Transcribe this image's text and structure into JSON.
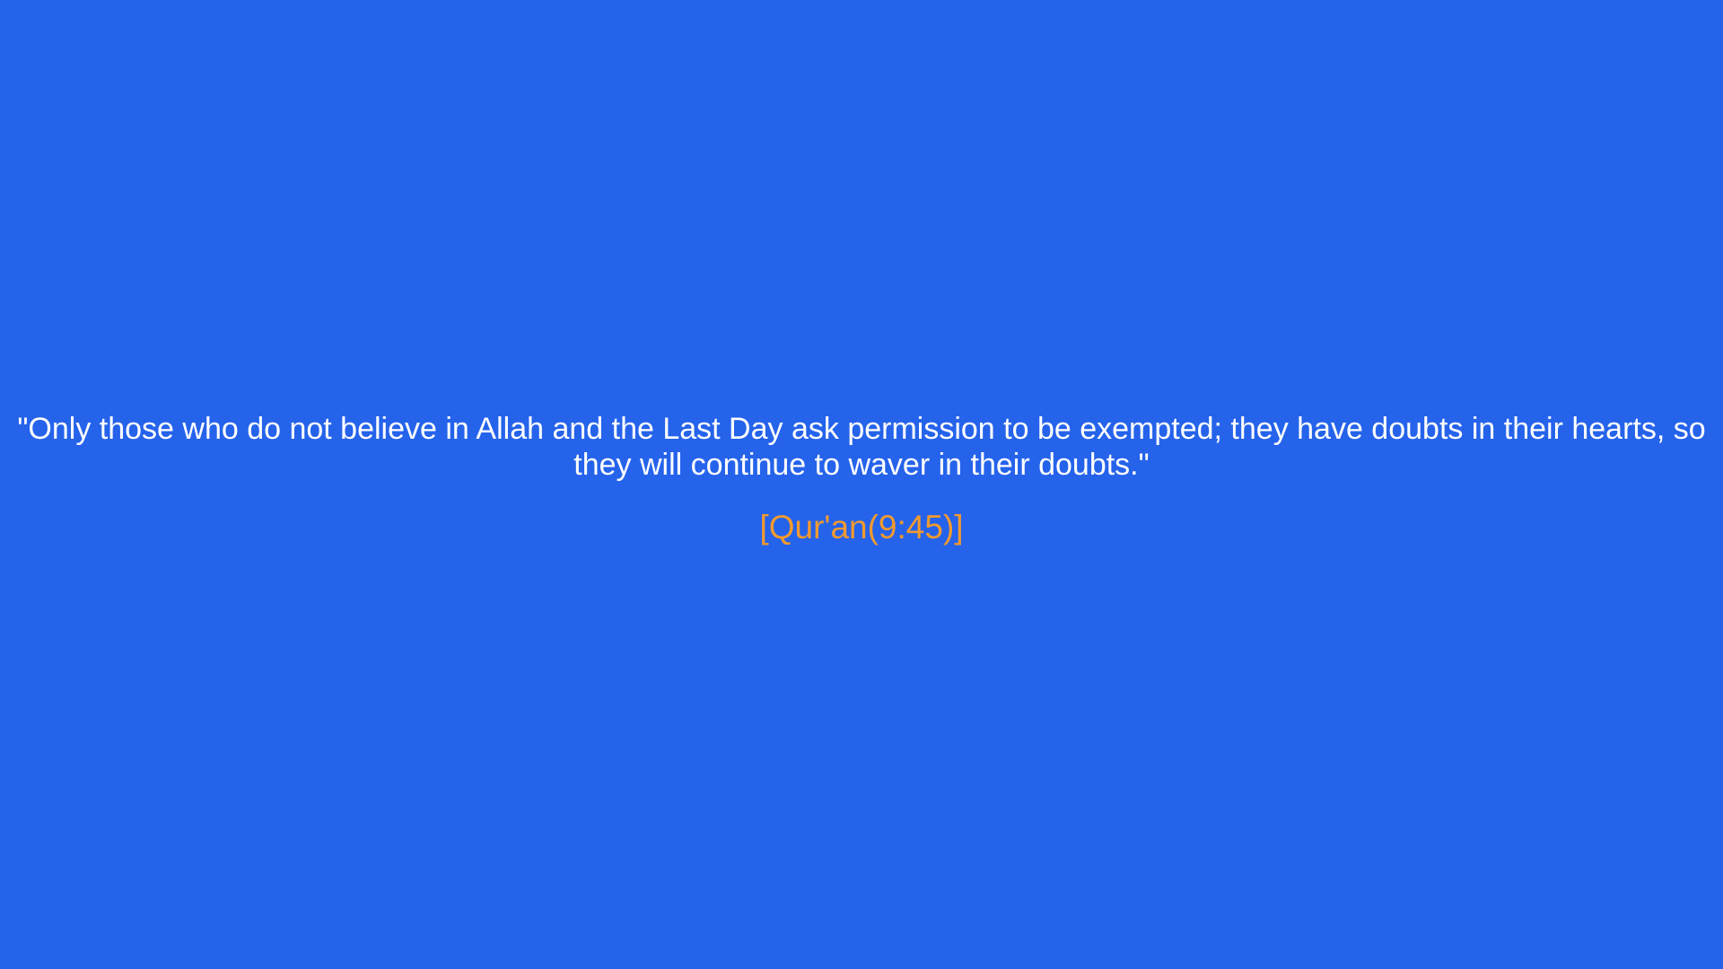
{
  "quote": {
    "text": "\"Only those who do not believe in Allah and the Last Day ask permission to be exempted; they have doubts in their hearts, so they will continue to waver in their doubts.\"",
    "citation": "[Qur'an(9:45)]"
  },
  "colors": {
    "background": "#2563eb",
    "quote_text": "#ffffff",
    "citation_text": "#f29a2e"
  }
}
